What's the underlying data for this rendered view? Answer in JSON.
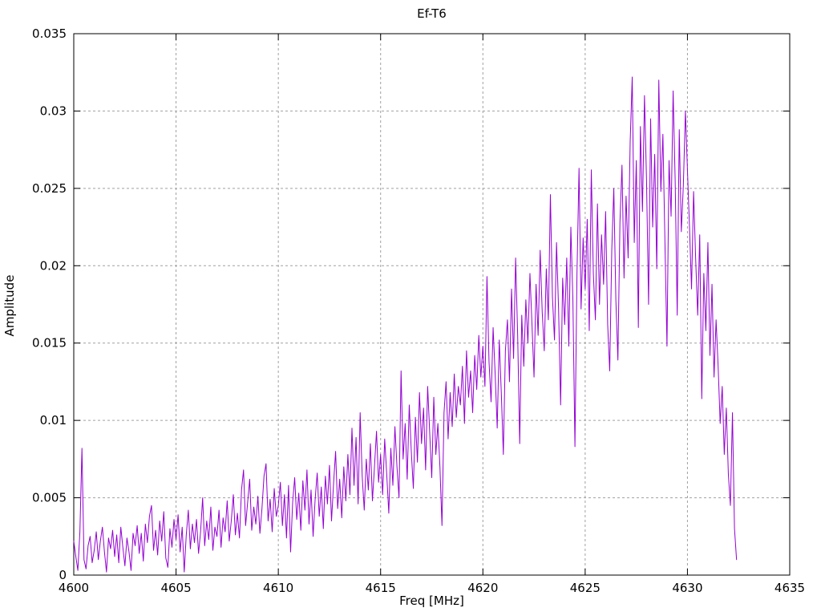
{
  "chart_data": {
    "type": "line",
    "title": "Ef-T6",
    "xlabel": "Freq [MHz]",
    "ylabel": "Amplitude",
    "xlim": [
      4600,
      4635
    ],
    "ylim": [
      0,
      0.035
    ],
    "x_ticks": [
      4600,
      4605,
      4610,
      4615,
      4620,
      4625,
      4630,
      4635
    ],
    "x_tick_labels": [
      "4600",
      "4605",
      "4610",
      "4615",
      "4620",
      "4625",
      "4630",
      "4635"
    ],
    "y_ticks": [
      0,
      0.005,
      0.01,
      0.015,
      0.02,
      0.025,
      0.03,
      0.035
    ],
    "y_tick_labels": [
      "0",
      "0.005",
      "0.01",
      "0.015",
      "0.02",
      "0.025",
      "0.03",
      "0.035"
    ],
    "grid": "dashed",
    "legend": "none",
    "line_color": "#9400d3",
    "grid_color": "#a0a0a0",
    "border_color": "#000000",
    "series": [
      {
        "name": "Ef-T6",
        "x_start": 4600.0,
        "x_step": 0.1,
        "values": [
          0.0022,
          0.0012,
          0.0003,
          0.0028,
          0.0082,
          0.001,
          0.0004,
          0.0019,
          0.0025,
          0.0008,
          0.0016,
          0.0028,
          0.001,
          0.0022,
          0.0031,
          0.0015,
          0.0002,
          0.0024,
          0.0017,
          0.0029,
          0.0012,
          0.0026,
          0.0008,
          0.0031,
          0.0018,
          0.0006,
          0.0024,
          0.0015,
          0.0003,
          0.0027,
          0.0019,
          0.0032,
          0.0014,
          0.0027,
          0.0009,
          0.0033,
          0.0021,
          0.0038,
          0.0045,
          0.0016,
          0.0029,
          0.0013,
          0.0035,
          0.0022,
          0.0041,
          0.0011,
          0.0005,
          0.003,
          0.0018,
          0.0036,
          0.0023,
          0.0039,
          0.0015,
          0.0031,
          0.0002,
          0.0026,
          0.0042,
          0.0017,
          0.0033,
          0.0021,
          0.0036,
          0.0014,
          0.0028,
          0.005,
          0.0019,
          0.0035,
          0.0023,
          0.0044,
          0.0016,
          0.0031,
          0.0025,
          0.0042,
          0.0018,
          0.0037,
          0.0028,
          0.0048,
          0.0022,
          0.0035,
          0.0052,
          0.0026,
          0.004,
          0.0024,
          0.0055,
          0.0068,
          0.0032,
          0.0047,
          0.0062,
          0.0029,
          0.0044,
          0.0033,
          0.0051,
          0.0027,
          0.0043,
          0.0064,
          0.0072,
          0.0035,
          0.0049,
          0.0028,
          0.0056,
          0.0038,
          0.0045,
          0.006,
          0.0032,
          0.0052,
          0.0024,
          0.0058,
          0.0015,
          0.0047,
          0.0063,
          0.0036,
          0.0053,
          0.0029,
          0.0061,
          0.0042,
          0.0068,
          0.0033,
          0.0055,
          0.0025,
          0.0049,
          0.0066,
          0.0038,
          0.0057,
          0.003,
          0.0064,
          0.0046,
          0.0071,
          0.0035,
          0.0059,
          0.008,
          0.0043,
          0.0062,
          0.0037,
          0.007,
          0.0048,
          0.0078,
          0.0052,
          0.0095,
          0.0058,
          0.0089,
          0.0046,
          0.0105,
          0.0064,
          0.0042,
          0.0075,
          0.0055,
          0.0085,
          0.0048,
          0.007,
          0.0093,
          0.006,
          0.0078,
          0.0052,
          0.0088,
          0.0065,
          0.004,
          0.0082,
          0.0058,
          0.0096,
          0.007,
          0.005,
          0.0132,
          0.0075,
          0.0098,
          0.0062,
          0.011,
          0.008,
          0.0056,
          0.0102,
          0.0073,
          0.0118,
          0.0085,
          0.0108,
          0.0068,
          0.0122,
          0.0092,
          0.0063,
          0.0115,
          0.0078,
          0.0098,
          0.007,
          0.0032,
          0.0105,
          0.0125,
          0.0088,
          0.0118,
          0.0096,
          0.013,
          0.0102,
          0.0122,
          0.011,
          0.0135,
          0.0098,
          0.0145,
          0.0115,
          0.0132,
          0.0105,
          0.0142,
          0.012,
          0.0155,
          0.0128,
          0.0148,
          0.0122,
          0.0193,
          0.0138,
          0.0112,
          0.016,
          0.013,
          0.0095,
          0.0152,
          0.0118,
          0.0078,
          0.0145,
          0.0165,
          0.0125,
          0.0185,
          0.014,
          0.0205,
          0.0155,
          0.0085,
          0.0168,
          0.0135,
          0.0178,
          0.015,
          0.0195,
          0.0162,
          0.0128,
          0.0188,
          0.0155,
          0.021,
          0.017,
          0.0145,
          0.0198,
          0.0165,
          0.0246,
          0.018,
          0.0152,
          0.0215,
          0.0172,
          0.011,
          0.0192,
          0.0162,
          0.0205,
          0.0148,
          0.0225,
          0.0178,
          0.0083,
          0.0195,
          0.0263,
          0.0172,
          0.0218,
          0.0185,
          0.023,
          0.0158,
          0.0262,
          0.0195,
          0.0165,
          0.024,
          0.0175,
          0.022,
          0.0188,
          0.0235,
          0.0162,
          0.0132,
          0.021,
          0.025,
          0.0178,
          0.0139,
          0.0228,
          0.0265,
          0.0192,
          0.0245,
          0.0205,
          0.028,
          0.0322,
          0.0215,
          0.0268,
          0.016,
          0.029,
          0.0235,
          0.031,
          0.0255,
          0.0175,
          0.0295,
          0.0225,
          0.0272,
          0.0198,
          0.032,
          0.0248,
          0.0285,
          0.0215,
          0.0148,
          0.0268,
          0.0232,
          0.0313,
          0.0255,
          0.0168,
          0.0288,
          0.0222,
          0.0252,
          0.03,
          0.0262,
          0.0225,
          0.0185,
          0.0248,
          0.0205,
          0.0168,
          0.022,
          0.0114,
          0.0195,
          0.0158,
          0.0215,
          0.0142,
          0.0188,
          0.0128,
          0.0165,
          0.0135,
          0.0098,
          0.0122,
          0.0078,
          0.0108,
          0.0065,
          0.0045,
          0.0105,
          0.003,
          0.001
        ]
      }
    ]
  }
}
